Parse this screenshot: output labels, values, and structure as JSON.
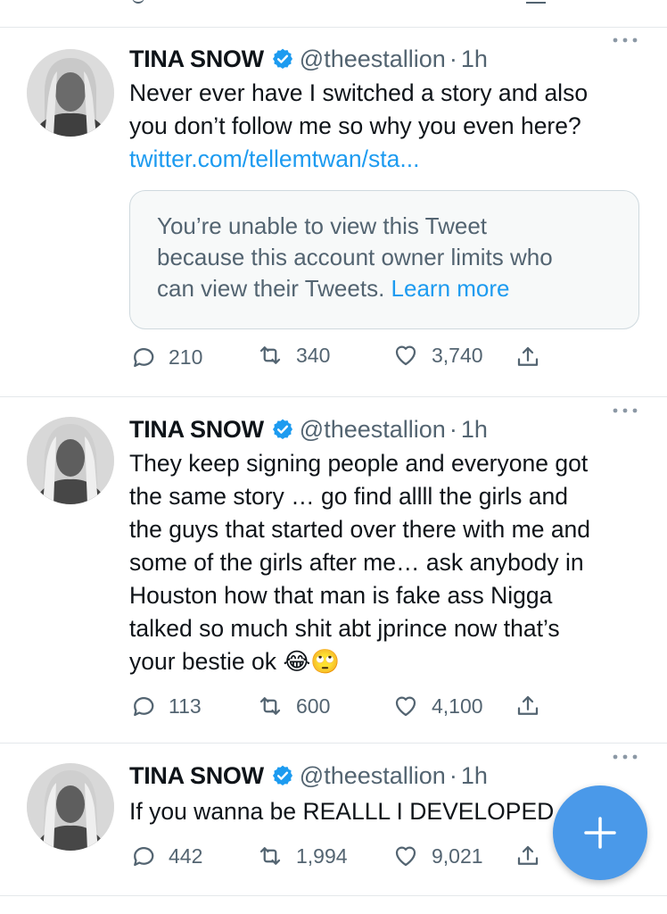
{
  "tweets": [
    {
      "name": "TINA SNOW",
      "handle": "@theestallion",
      "separator": "·",
      "time": "1h",
      "text_line1": "Never ever have I switched a story and also",
      "text_line2": "you don’t follow me so why you even here?",
      "link": "twitter.com/tellemtwan/sta...",
      "quote": {
        "line1": "You’re unable to view this Tweet",
        "line2": "because this account owner limits who",
        "line3": "can view their Tweets.",
        "learn_more": "Learn more"
      },
      "replies": "210",
      "retweets": "340",
      "likes": "3,740"
    },
    {
      "name": "TINA SNOW",
      "handle": "@theestallion",
      "separator": "·",
      "time": "1h",
      "lines": [
        "They keep signing people and everyone got",
        "the same story … go find allll the girls and",
        "the guys that started over there with me and",
        "some of the girls after me… ask anybody in",
        "Houston how that man is fake ass Nigga",
        "talked so much shit abt jprince now that’s",
        "your bestie ok 😂🙄"
      ],
      "replies": "113",
      "retweets": "600",
      "likes": "4,100"
    },
    {
      "name": "TINA SNOW",
      "handle": "@theestallion",
      "separator": "·",
      "time": "1h",
      "text_line1": "If you wanna be REALLL I DEVELOPED",
      "replies": "442",
      "retweets": "1,994",
      "likes": "9,021"
    }
  ],
  "icons": {
    "verified": "verified-badge-icon",
    "more": "more-dots-icon",
    "reply": "reply-icon",
    "retweet": "retweet-icon",
    "like": "heart-icon",
    "share": "share-icon",
    "compose": "plus-icon"
  },
  "colors": {
    "accent": "#1d9bf0",
    "fab": "#4a99e9",
    "secondary_text": "#536471"
  }
}
